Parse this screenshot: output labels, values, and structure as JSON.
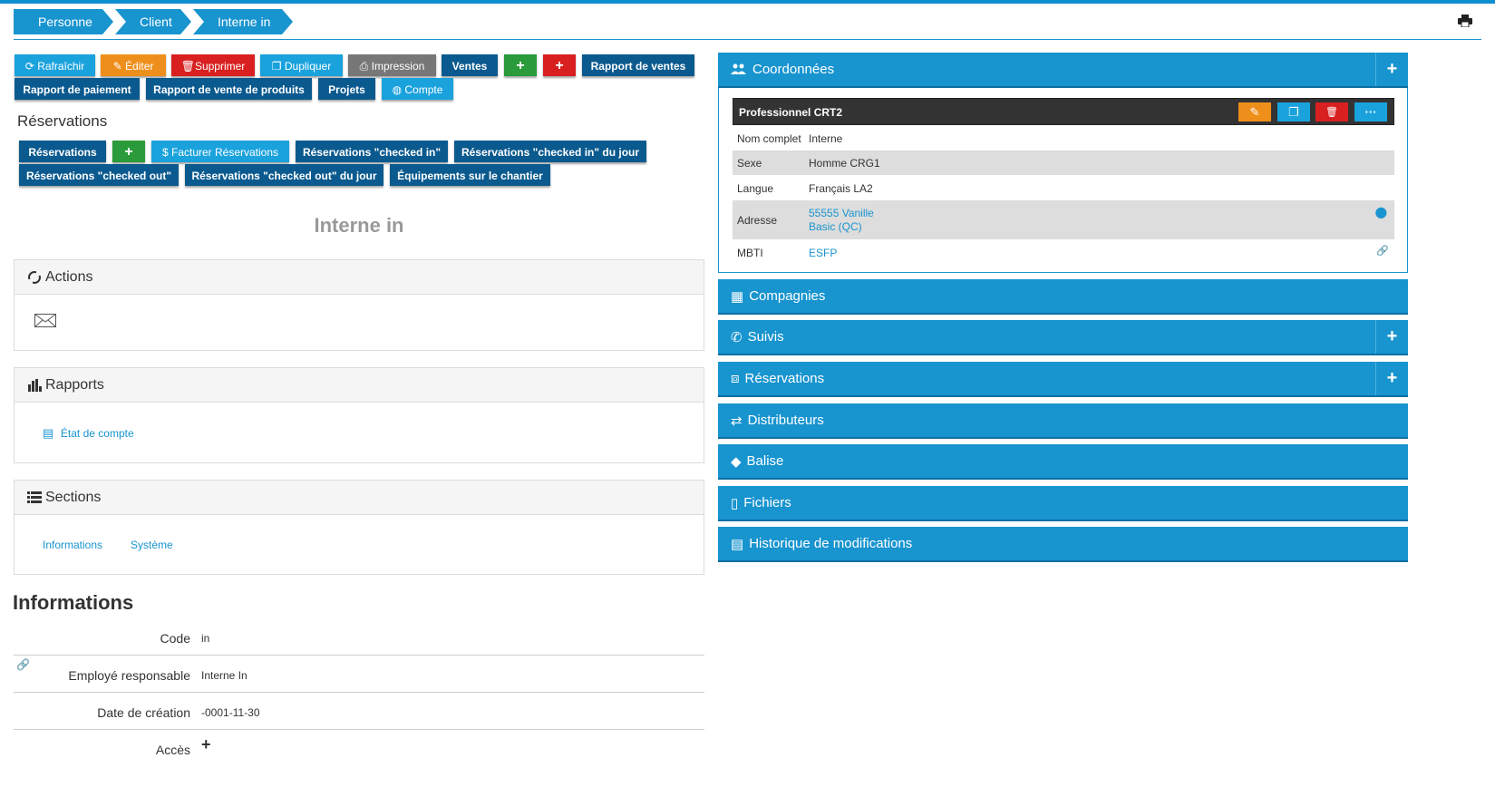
{
  "breadcrumb": [
    "Personne",
    "Client",
    "Interne in"
  ],
  "toolbar": {
    "refresh": "Rafraîchir",
    "edit": "Éditer",
    "delete": "Supprimer",
    "duplicate": "Dupliquer",
    "print": "Impression",
    "sales": "Ventes",
    "plus": "+",
    "sales_report": "Rapport de ventes",
    "payment_report": "Rapport de paiement",
    "product_sales_report": "Rapport de vente de produits",
    "projects": "Projets",
    "account": "Compte"
  },
  "reservations": {
    "title": "Réservations",
    "btn_reservations": "Réservations",
    "btn_bill": "Facturer Réservations",
    "btn_checked_in": "Réservations \"checked in\"",
    "btn_checked_in_day": "Réservations \"checked in\" du jour",
    "btn_checked_out": "Réservations \"checked out\"",
    "btn_checked_out_day": "Réservations \"checked out\" du jour",
    "btn_equipment": "Équipements sur le chantier"
  },
  "entity_title": "Interne in",
  "actions_panel": {
    "title": "Actions"
  },
  "reports_panel": {
    "title": "Rapports",
    "link": "État de compte"
  },
  "sections_panel": {
    "title": "Sections",
    "links": [
      "Informations",
      "Système"
    ]
  },
  "informations": {
    "title": "Informations",
    "rows": [
      {
        "label": "Code",
        "value": "in"
      },
      {
        "label": "Employé responsable",
        "value": "Interne In"
      },
      {
        "label": "Date de création",
        "value": "-0001-11-30"
      },
      {
        "label": "Accès",
        "value": "+"
      }
    ]
  },
  "coordinates": {
    "title": "Coordonnées",
    "card_title": "Professionnel CRT2",
    "more_label": "···",
    "rows": [
      {
        "label": "Nom complet",
        "value": "Interne"
      },
      {
        "label": "Sexe",
        "value": "Homme CRG1"
      },
      {
        "label": "Langue",
        "value": "Français LA2"
      },
      {
        "label": "Adresse",
        "value_line1": "55555 Vanille",
        "value_line2": "Basic (QC)"
      },
      {
        "label": "MBTI",
        "value": "ESFP"
      }
    ]
  },
  "right_panels": [
    {
      "title": "Compagnies",
      "icon": "building-icon",
      "plus": false
    },
    {
      "title": "Suivis",
      "icon": "phone-icon",
      "plus": true
    },
    {
      "title": "Réservations",
      "icon": "inbox-icon",
      "plus": true
    },
    {
      "title": "Distributeurs",
      "icon": "exchange-icon",
      "plus": false
    },
    {
      "title": "Balise",
      "icon": "tag-icon",
      "plus": false
    },
    {
      "title": "Fichiers",
      "icon": "file-icon",
      "plus": false
    },
    {
      "title": "Historique de modifications",
      "icon": "history-icon",
      "plus": false
    }
  ],
  "colors": {
    "primary": "#1894cf",
    "navy": "#0b5a8f",
    "orange": "#ef8f1b",
    "red": "#d92020",
    "green": "#2a9a3a"
  }
}
